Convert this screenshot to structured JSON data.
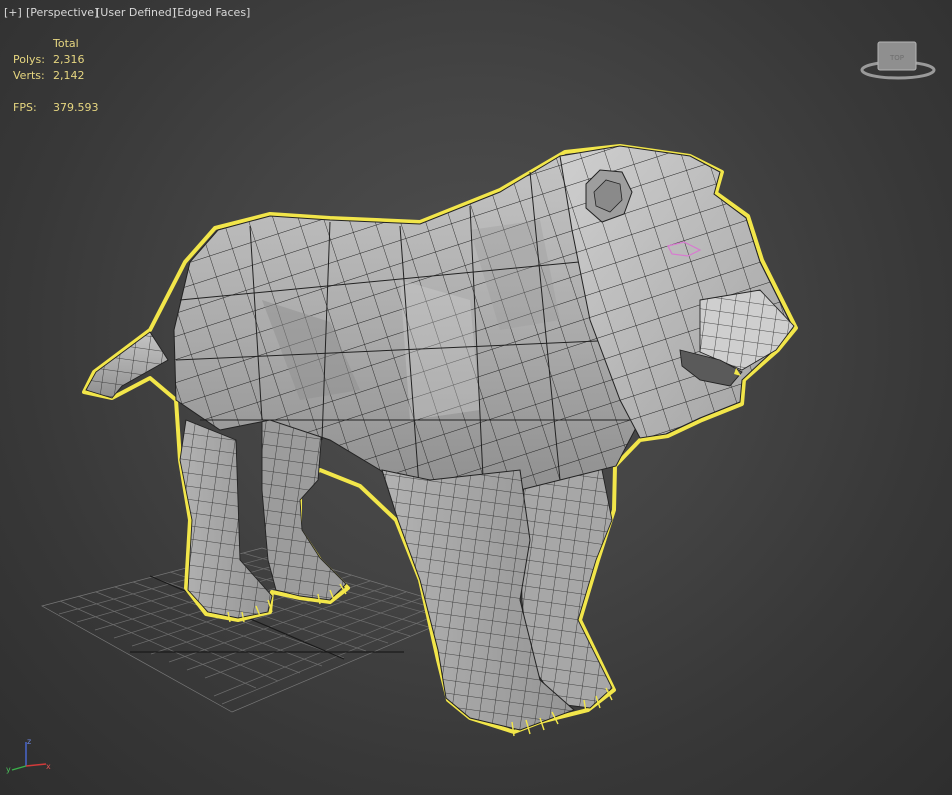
{
  "viewport": {
    "labels": {
      "plus": "[+]",
      "view": "[Perspective]",
      "shading_mode": "[User Defined]",
      "display_mode": "[Edged Faces]"
    },
    "stats": {
      "column_header": "Total",
      "polys_label": "Polys:",
      "polys_value": "2,316",
      "verts_label": "Verts:",
      "verts_value": "2,142",
      "fps_label": "FPS:",
      "fps_value": "379.593"
    },
    "viewcube": {
      "face_label": "TOP"
    },
    "axis_tripod": {
      "x_label": "x",
      "y_label": "y",
      "z_label": "z"
    },
    "colors": {
      "selection_outline": "#f2e64a",
      "stats_text": "#e6d680",
      "label_text": "#d8d8d8",
      "mesh_fill": "#b8b8b8",
      "wire": "#202020",
      "grid": "#6c6c6c",
      "axis_x": "#d23a3a",
      "axis_y": "#3ab24a",
      "axis_z": "#4a6ad8"
    }
  }
}
